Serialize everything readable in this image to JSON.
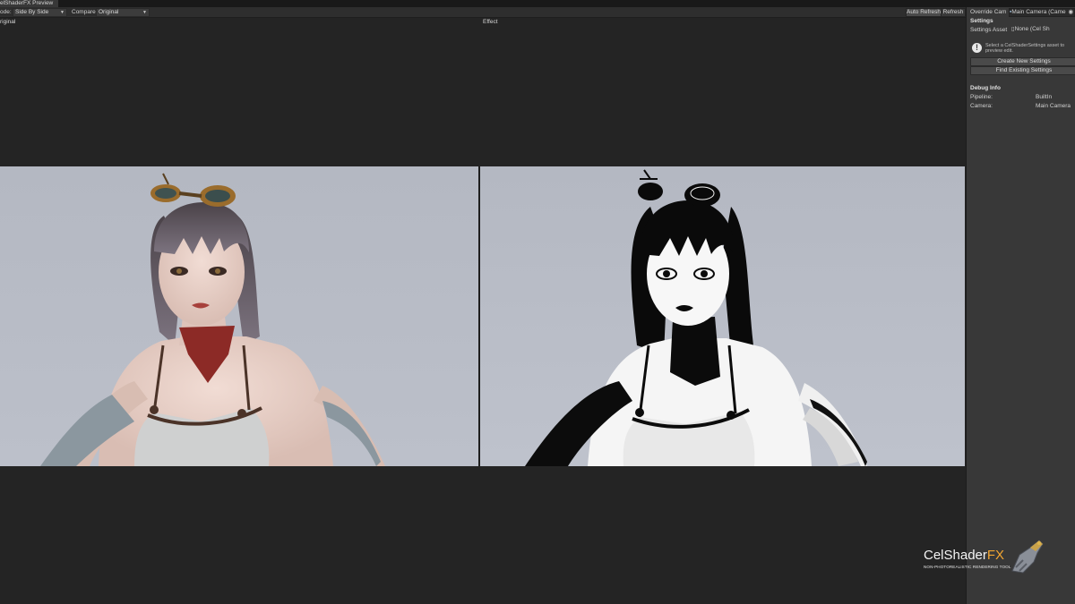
{
  "window": {
    "tab_title": "elShaderFX Preview"
  },
  "toolbar": {
    "mode_label": "ode:",
    "mode_value": "Side By Side",
    "compare_label": "Compare:",
    "compare_value": "Original",
    "auto_refresh_label": "Auto Refresh",
    "refresh_label": "Refresh"
  },
  "views": {
    "original_label": "riginal",
    "effect_label": "Effect"
  },
  "inspector": {
    "override_camera_label": "Override Cam",
    "override_camera_value": "Main Camera (Came",
    "settings_header": "Settings",
    "settings_asset_label": "Settings Asset",
    "settings_asset_value": "None (Cel Sh",
    "info_message": "Select a CelShaderSettings asset to preview edit.",
    "create_button": "Create New Settings",
    "find_button": "Find Existing Settings",
    "debug_header": "Debug Info",
    "pipeline_label": "Pipeline:",
    "pipeline_value": "BuiltIn",
    "camera_label": "Camera:",
    "camera_value": "Main Camera"
  },
  "logo": {
    "title_main": "CelShader",
    "title_accent": "FX",
    "subtitle": "NON-PHOTOREALISTIC RENDERING TOOL"
  },
  "colors": {
    "editor_bg": "#242424",
    "panel_bg": "#383838",
    "viewport_bg": "#b8bcc6",
    "logo_accent": "#f2a531"
  }
}
